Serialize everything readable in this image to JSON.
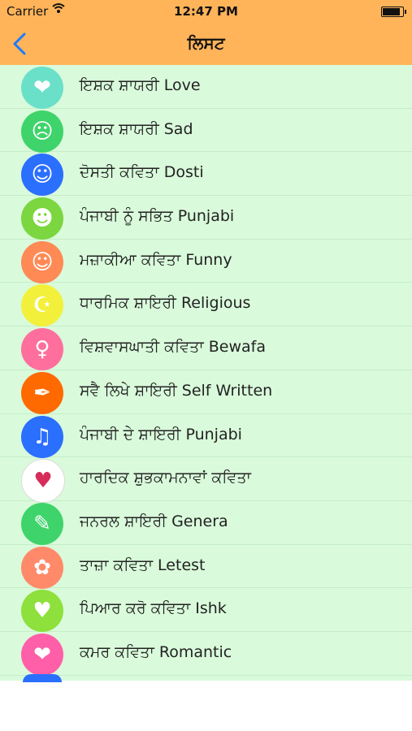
{
  "status_bar": {
    "carrier": "Carrier",
    "time": "12:47 PM",
    "battery_level": 0.95
  },
  "nav": {
    "title": "ਲਿਸਟ",
    "back_icon": "chevron-left-icon"
  },
  "items": [
    {
      "label": "ਇਸ਼ਕ ਸ਼ਾਯਰੀ  Love",
      "icon": "hearts-icon",
      "color": "#6be0c9",
      "glyph": "❤"
    },
    {
      "label": "ਇਸ਼ਕ ਸ਼ਾਯਰੀ Sad",
      "icon": "sad-couple-icon",
      "color": "#3fd46b",
      "glyph": "☹"
    },
    {
      "label": "ਦੋਸਤੀ ਕਵਿਤਾ Dosti",
      "icon": "friends-icon",
      "color": "#2b6fff",
      "glyph": "☺"
    },
    {
      "label": "ਪੰਜਾਬੀ ਨੂੰ ਸਭਿਤ Punjabi",
      "icon": "turban-icon",
      "color": "#7bd63f",
      "glyph": "☻"
    },
    {
      "label": "ਮਜ਼ਾਕੀਆ ਕਵਿਤਾ Funny",
      "icon": "funny-icon",
      "color": "#ff8a55",
      "glyph": "☺"
    },
    {
      "label": "ਧਾਰਮਿਕ ਸ਼ਾਇਰੀ Religious",
      "icon": "religious-symbols-icon",
      "color": "#f3f03b",
      "glyph": "☪"
    },
    {
      "label": "ਵਿਸ਼ਵਾਸਘਾਤੀ ਕਵਿਤਾ Bewafa",
      "icon": "girl-icon",
      "color": "#ff6f9e",
      "glyph": "♀"
    },
    {
      "label": "ਸਵੈ ਲਿਖੇ ਸ਼ਾਇਰੀ Self Written",
      "icon": "quill-icon",
      "color": "#ff6a00",
      "glyph": "✒"
    },
    {
      "label": "ਪੰਜਾਬੀ ਦੇ ਸ਼ਾਇਰੀ Punjabi",
      "icon": "dancer-icon",
      "color": "#2b6fff",
      "glyph": "♫"
    },
    {
      "label": "ਹਾਰਦਿਕ ਸ਼ੁਭਕਾਮਨਾਵਾਂ ਕਵਿਤਾ",
      "icon": "heart-card-icon",
      "color": "#ffffff",
      "glyph": "♥"
    },
    {
      "label": "ਜਨਰਲ ਸ਼ਾਇਰੀ Genera",
      "icon": "feather-icon",
      "color": "#3fd46b",
      "glyph": "✎"
    },
    {
      "label": "ਤਾਜ਼ਾ ਕਵਿਤਾ Letest",
      "icon": "roses-icon",
      "color": "#ff8a6a",
      "glyph": "✿"
    },
    {
      "label": "ਪਿਆਰ ਕਰੋ ਕਵਿਤਾ Ishk",
      "icon": "love-couple-icon",
      "color": "#8ee03c",
      "glyph": "♥"
    },
    {
      "label": "ਕਮਰ ਕਵਿਤਾ Romantic",
      "icon": "kissing-couple-icon",
      "color": "#ff5fa8",
      "glyph": "❤"
    }
  ]
}
